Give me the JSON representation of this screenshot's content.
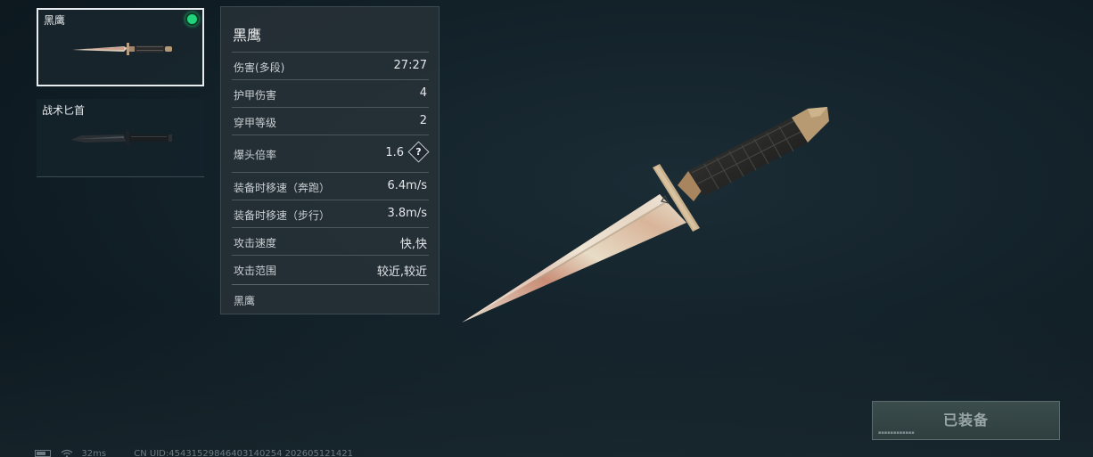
{
  "weapons": [
    {
      "name": "黑鹰",
      "selected": true,
      "equipped": true
    },
    {
      "name": "战术匕首",
      "selected": false,
      "equipped": false
    }
  ],
  "stats_panel": {
    "title": "黑鹰",
    "rows": [
      {
        "label": "伤害(多段)",
        "value": "27:27"
      },
      {
        "label": "护甲伤害",
        "value": "4"
      },
      {
        "label": "穿甲等级",
        "value": "2"
      },
      {
        "label": "爆头倍率",
        "value": "1.6",
        "help": "?"
      },
      {
        "label": "装备时移速（奔跑）",
        "value": "6.4m/s"
      },
      {
        "label": "装备时移速（步行）",
        "value": "3.8m/s"
      },
      {
        "label": "攻击速度",
        "value": "快,快"
      },
      {
        "label": "攻击范围",
        "value": "较近,较近"
      }
    ],
    "footer": "黑鹰"
  },
  "equip_button": {
    "label": "已装备",
    "state": "disabled"
  },
  "status_bar": {
    "ping": "32ms",
    "uid": "CN UID:454315298464031402​54 202605121421"
  },
  "icons": {
    "equipped_indicator": "green-dot-icon",
    "help": "question-diamond-icon",
    "battery": "battery-icon",
    "wifi": "wifi-icon"
  },
  "colors": {
    "equipped_green": "#20d27a",
    "background": "#14232b",
    "panel": "#283238"
  }
}
